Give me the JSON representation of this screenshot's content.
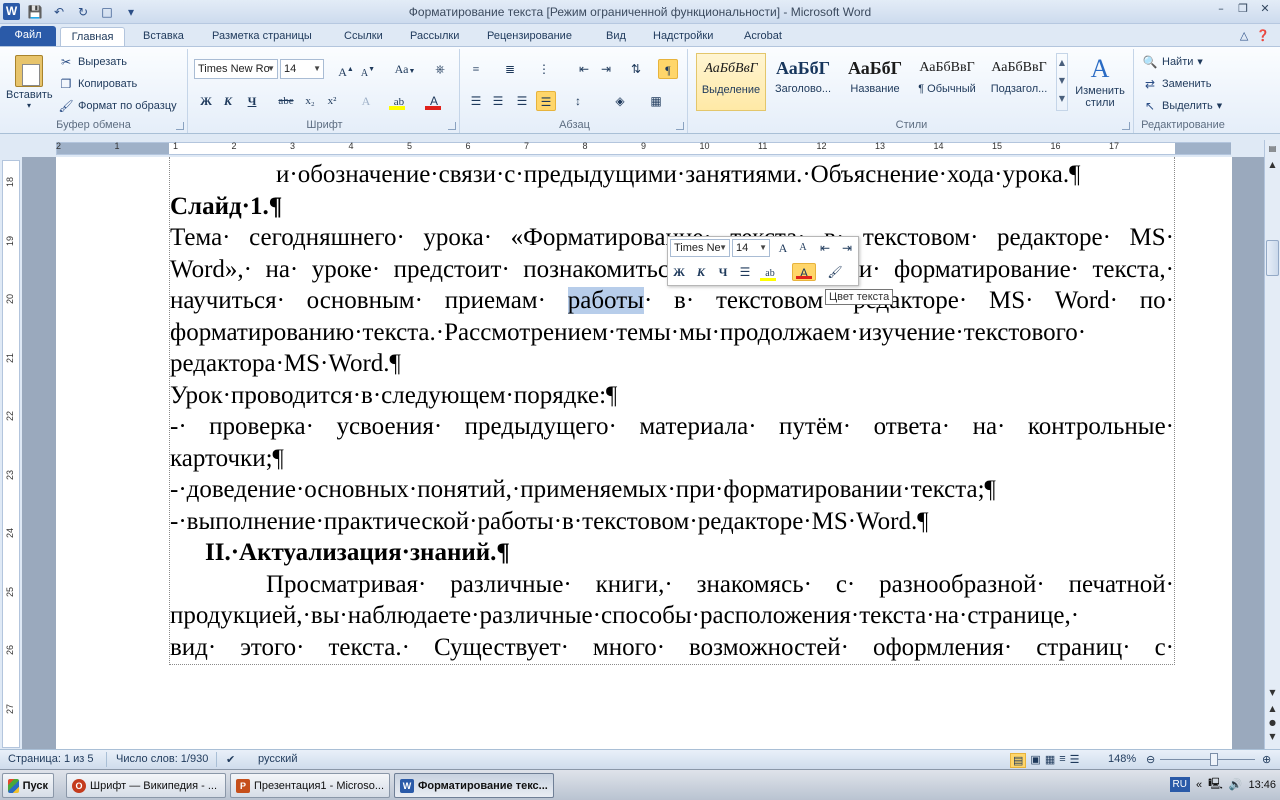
{
  "window": {
    "title": "Форматирование текста [Режим ограниченной функциональности]  -  Microsoft Word"
  },
  "ribbon_tabs": [
    "Файл",
    "Главная",
    "Вставка",
    "Разметка страницы",
    "Ссылки",
    "Рассылки",
    "Рецензирование",
    "Вид",
    "Надстройки",
    "Acrobat"
  ],
  "clipboard": {
    "paste_label": "Вставить",
    "cut_label": "Вырезать",
    "copy_label": "Копировать",
    "format_painter_label": "Формат по образцу",
    "group_label": "Буфер обмена"
  },
  "font": {
    "font_name": "Times New Ro",
    "font_size": "14",
    "group_label": "Шрифт",
    "case_label": "Аа",
    "bold": "Ж",
    "italic": "К",
    "underline": "Ч",
    "strike": "abe",
    "subscript": "x₂",
    "superscript": "x²"
  },
  "paragraph": {
    "group_label": "Абзац"
  },
  "styles": {
    "group_label": "Стили",
    "items": [
      {
        "sample": "АаБбВвГ",
        "name": "Выделение"
      },
      {
        "sample": "АаБбГ",
        "name": "Заголово..."
      },
      {
        "sample": "АаБбГ",
        "name": "Название"
      },
      {
        "sample": "АаБбВвГ",
        "name": "¶ Обычный"
      },
      {
        "sample": "АаБбВвГ",
        "name": "Подзагол..."
      }
    ],
    "change_styles_label": "Изменить стили"
  },
  "editing": {
    "group_label": "Редактирование",
    "find_label": "Найти",
    "replace_label": "Заменить",
    "select_label": "Выделить"
  },
  "ruler_numbers": [
    "2",
    "1",
    "1",
    "2",
    "3",
    "4",
    "5",
    "6",
    "7",
    "8",
    "9",
    "10",
    "11",
    "12",
    "13",
    "14",
    "15",
    "16",
    "17"
  ],
  "vruler_numbers": [
    "18",
    "19",
    "20",
    "21",
    "22",
    "23",
    "24",
    "25",
    "26",
    "27"
  ],
  "document": {
    "lines": [
      "и·обозначение·связи·с·предыдущими·занятиями.·Объяснение·хода·урока.¶",
      "Слайд·1.¶",
      "Тема· сегодняшнего· урока· «Форматирование· текста· в· текстовом· редакторе· MS·",
      "Word»,· на· уроке· предстоит· познакомиться· с· понятием· и· форматирование· текста,·",
      "научиться· основным· приемам·",
      "работы",
      "· в· текстовом· редакторе· MS· Word· по·",
      "форматированию·текста.·Рассмотрением·темы·мы·продолжаем·изучение·текстового·",
      "редактора·MS·Word.¶",
      "Урок·проводится·в·следующем·порядке:¶",
      "-· проверка· усвоения· предыдущего· материала· путём· ответа· на· контрольные·",
      "карточки;¶",
      "-·доведение·основных·понятий,·применяемых·при·форматировании·текста;¶",
      "-·выполнение·практической·работы·в·текстовом·редакторе·MS·Word.¶",
      "II.·Актуализация·знаний.¶",
      "Просматривая· различные· книги,· знакомясь· с· разнообразной· печатной·",
      "продукцией,·вы·наблюдаете·различные·способы·расположения·текста·на·странице,·",
      "вид· этого· текста.· Существует· много· возможностей· оформления· страниц· с·"
    ]
  },
  "mini_toolbar": {
    "font_name": "Times Ne",
    "font_size": "14",
    "tooltip": "Цвет текста"
  },
  "status": {
    "page": "Страница: 1 из 5",
    "words": "Число слов: 1/930",
    "language": "русский",
    "zoom": "148%"
  },
  "taskbar": {
    "start_label": "Пуск",
    "tasks": [
      {
        "label": "Шрифт — Википедия - ...",
        "icon_color": "#c43b1d",
        "icon": "O"
      },
      {
        "label": "Презентация1 - Microso...",
        "icon_color": "#c6501c",
        "icon": "P"
      },
      {
        "label": "Форматирование текс...",
        "icon_color": "#2a5aa8",
        "icon": "W"
      }
    ],
    "lang": "RU",
    "time": "13:46"
  }
}
